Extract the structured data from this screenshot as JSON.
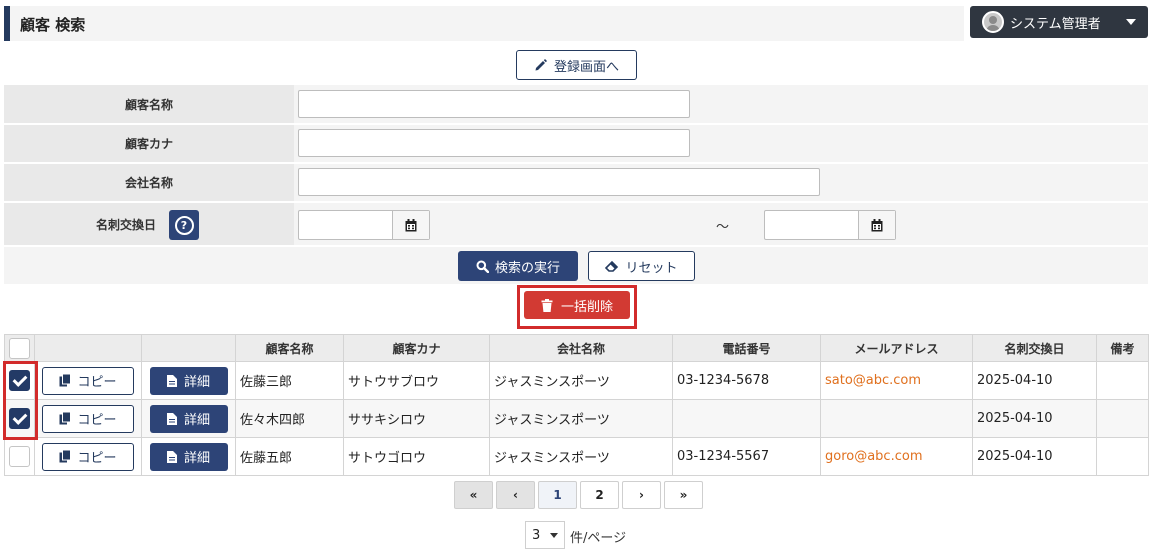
{
  "header": {
    "title": "顧客 検索",
    "user_name": "システム管理者"
  },
  "actions": {
    "register_label": "登録画面へ",
    "search_label": "検索の実行",
    "reset_label": "リセット",
    "bulk_delete_label": "一括削除"
  },
  "form": {
    "customer_name_label": "顧客名称",
    "customer_kana_label": "顧客カナ",
    "company_name_label": "会社名称",
    "card_exchange_label": "名刺交換日",
    "help_symbol": "?",
    "range_separator": "～"
  },
  "table": {
    "headers": [
      "",
      "",
      "",
      "顧客名称",
      "顧客カナ",
      "会社名称",
      "電話番号",
      "メールアドレス",
      "名刺交換日",
      "備考"
    ],
    "copy_label": "コピー",
    "detail_label": "詳細",
    "rows": [
      {
        "checked": true,
        "name": "佐藤三郎",
        "kana": "サトウサブロウ",
        "company": "ジャスミンスポーツ",
        "phone": "03-1234-5678",
        "email": "sato@abc.com",
        "date": "2025-04-10",
        "note": ""
      },
      {
        "checked": true,
        "name": "佐々木四郎",
        "kana": "ササキシロウ",
        "company": "ジャスミンスポーツ",
        "phone": "",
        "email": "",
        "date": "2025-04-10",
        "note": ""
      },
      {
        "checked": false,
        "name": "佐藤五郎",
        "kana": "サトウゴロウ",
        "company": "ジャスミンスポーツ",
        "phone": "03-1234-5567",
        "email": "goro@abc.com",
        "date": "2025-04-10",
        "note": ""
      }
    ]
  },
  "pagination": {
    "first": "«",
    "prev": "‹",
    "pages": [
      "1",
      "2"
    ],
    "next": "›",
    "last": "»",
    "current_page": "1"
  },
  "per_page": {
    "value": "3",
    "label": "件/ページ"
  },
  "colors": {
    "primary": "#2d4477",
    "danger": "#d23a33",
    "highlight_frame": "#d22b2b",
    "email": "#e0701e"
  }
}
